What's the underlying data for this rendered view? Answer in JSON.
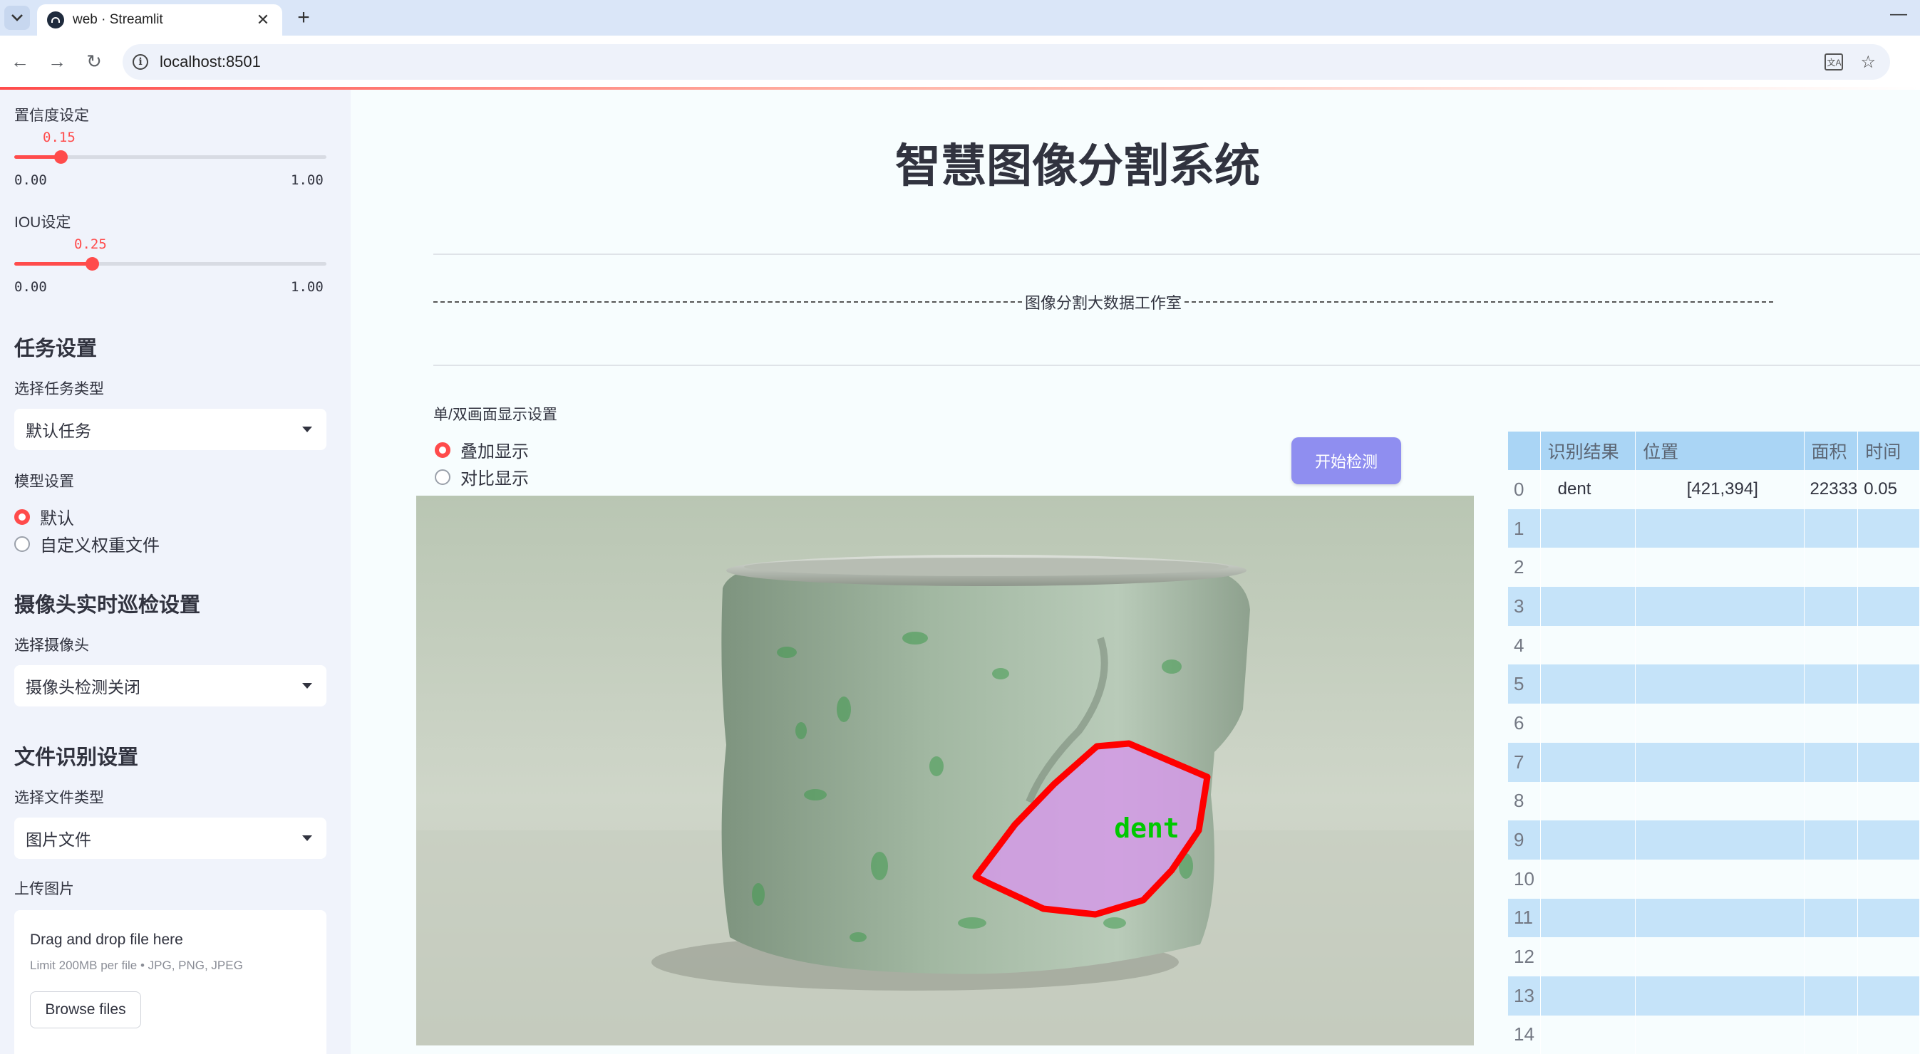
{
  "browser": {
    "tab_title": "web · Streamlit",
    "url": "localhost:8501"
  },
  "sidebar": {
    "confidence": {
      "label": "置信度设定",
      "value": "0.15",
      "value_fraction": 0.15,
      "min": "0.00",
      "max": "1.00"
    },
    "iou": {
      "label": "IOU设定",
      "value": "0.25",
      "value_fraction": 0.25,
      "min": "0.00",
      "max": "1.00"
    },
    "task_heading": "任务设置",
    "task_type_label": "选择任务类型",
    "task_type_value": "默认任务",
    "model_label": "模型设置",
    "model_options": [
      {
        "label": "默认",
        "selected": true
      },
      {
        "label": "自定义权重文件",
        "selected": false
      }
    ],
    "camera_heading": "摄像头实时巡检设置",
    "camera_label": "选择摄像头",
    "camera_value": "摄像头检测关闭",
    "file_heading": "文件识别设置",
    "file_type_label": "选择文件类型",
    "file_type_value": "图片文件",
    "upload_label": "上传图片",
    "upload_title": "Drag and drop file here",
    "upload_limit": "Limit 200MB per file • JPG, PNG, JPEG",
    "browse_label": "Browse files"
  },
  "main": {
    "title": "智慧图像分割系统",
    "studio_text": "图像分割大数据工作室",
    "display_label": "单/双画面显示设置",
    "display_options": [
      {
        "label": "叠加显示",
        "selected": true
      },
      {
        "label": "对比显示",
        "selected": false
      }
    ],
    "start_button": "开始检测",
    "detection_label": "dent"
  },
  "table": {
    "headers": [
      "",
      "识别结果",
      "位置",
      "面积",
      "时间"
    ],
    "rows": [
      [
        "0",
        "dent",
        "[421,394]",
        "22333",
        "0.05"
      ],
      [
        "1",
        "",
        "",
        "",
        ""
      ],
      [
        "2",
        "",
        "",
        "",
        ""
      ],
      [
        "3",
        "",
        "",
        "",
        ""
      ],
      [
        "4",
        "",
        "",
        "",
        ""
      ],
      [
        "5",
        "",
        "",
        "",
        ""
      ],
      [
        "6",
        "",
        "",
        "",
        ""
      ],
      [
        "7",
        "",
        "",
        "",
        ""
      ],
      [
        "8",
        "",
        "",
        "",
        ""
      ],
      [
        "9",
        "",
        "",
        "",
        ""
      ],
      [
        "10",
        "",
        "",
        "",
        ""
      ],
      [
        "11",
        "",
        "",
        "",
        ""
      ],
      [
        "12",
        "",
        "",
        "",
        ""
      ],
      [
        "13",
        "",
        "",
        "",
        ""
      ],
      [
        "14",
        "",
        "",
        "",
        ""
      ]
    ]
  },
  "colors": {
    "accent": "#ff4b4b",
    "button": "#8f8ef0",
    "table_header": "#aad5f5",
    "table_alt_row": "#c5e3f9",
    "sidebar_bg": "#f0f3fb",
    "mask_outline": "#ff0000",
    "mask_fill": "#d49ae6",
    "label_green": "#00c800"
  },
  "icons": [
    "tab-list-icon",
    "streamlit-favicon",
    "close-icon",
    "plus-icon",
    "minimize-icon",
    "back-icon",
    "forward-icon",
    "reload-icon",
    "info-icon",
    "translate-icon",
    "star-icon",
    "chevron-down-icon"
  ]
}
